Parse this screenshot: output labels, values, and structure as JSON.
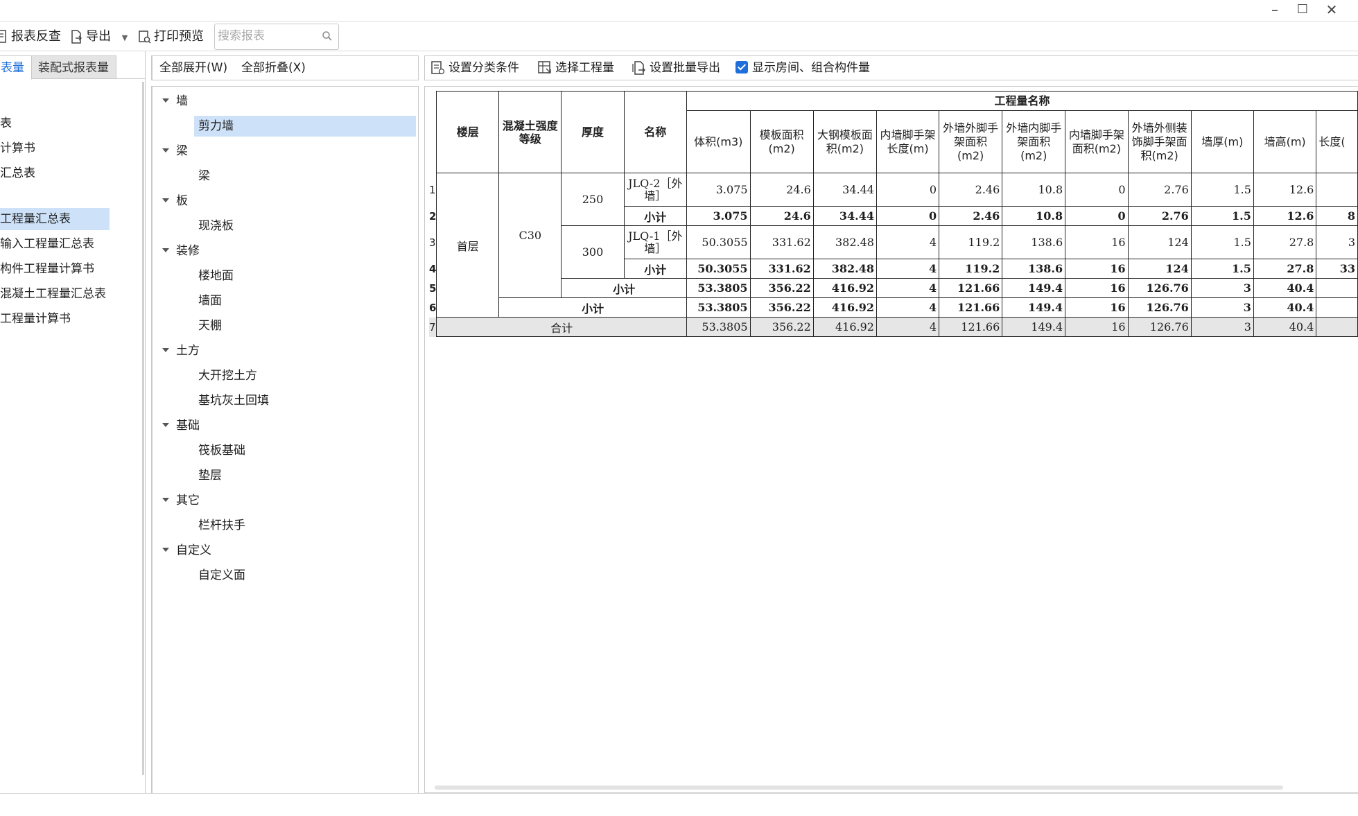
{
  "toolbar": {
    "report_check": "报表反查",
    "export": "导出",
    "print_preview": "打印预览",
    "search_placeholder": "搜索报表"
  },
  "left_panel": {
    "tabs": [
      {
        "label": "表量",
        "active": true
      },
      {
        "label": "装配式报表量",
        "active": false
      }
    ],
    "items": [
      {
        "label": "表",
        "selected": false
      },
      {
        "label": "计算书",
        "selected": false
      },
      {
        "label": "汇总表",
        "selected": false
      },
      {
        "label": "",
        "selected": false
      },
      {
        "label": "工程量汇总表",
        "selected": true
      },
      {
        "label": "输入工程量汇总表",
        "selected": false
      },
      {
        "label": "构件工程量计算书",
        "selected": false
      },
      {
        "label": "混凝土工程量汇总表",
        "selected": false
      },
      {
        "label": "工程量计算书",
        "selected": false
      }
    ]
  },
  "middle_panel": {
    "expand_all": "全部展开(W)",
    "collapse_all": "全部折叠(X)",
    "tree": [
      {
        "group": "墙",
        "children": [
          {
            "label": "剪力墙",
            "selected": true
          }
        ]
      },
      {
        "group": "梁",
        "children": [
          {
            "label": "梁",
            "selected": false
          }
        ]
      },
      {
        "group": "板",
        "children": [
          {
            "label": "现浇板",
            "selected": false
          }
        ]
      },
      {
        "group": "装修",
        "children": [
          {
            "label": "楼地面",
            "selected": false
          },
          {
            "label": "墙面",
            "selected": false
          },
          {
            "label": "天棚",
            "selected": false
          }
        ]
      },
      {
        "group": "土方",
        "children": [
          {
            "label": "大开挖土方",
            "selected": false
          },
          {
            "label": "基坑灰土回填",
            "selected": false
          }
        ]
      },
      {
        "group": "基础",
        "children": [
          {
            "label": "筏板基础",
            "selected": false
          },
          {
            "label": "垫层",
            "selected": false
          }
        ]
      },
      {
        "group": "其它",
        "children": [
          {
            "label": "栏杆扶手",
            "selected": false
          }
        ]
      },
      {
        "group": "自定义",
        "children": [
          {
            "label": "自定义面",
            "selected": false
          }
        ]
      }
    ]
  },
  "right_panel": {
    "set_category": "设置分类条件",
    "select_quantity": "选择工程量",
    "batch_export": "设置批量导出",
    "show_rooms": "显示房间、组合构件量",
    "show_rooms_checked": true
  },
  "table": {
    "group_header": "工程量名称",
    "headers": [
      "楼层",
      "混凝土强度等级",
      "厚度",
      "名称"
    ],
    "sub_headers": [
      "体积(m3)",
      "模板面积(m2)",
      "大钢模板面积(m2)",
      "内墙脚手架长度(m)",
      "外墙外脚手架面积(m2)",
      "外墙内脚手架面积(m2)",
      "内墙脚手架面积(m2)",
      "外墙外侧装饰脚手架面积(m2)",
      "墙厚(m)",
      "墙高(m)",
      "长度("
    ],
    "floor": "首层",
    "grade": "C30",
    "row_numbers": [
      "1",
      "2",
      "3",
      "4",
      "5",
      "6",
      "7"
    ],
    "thickness": [
      "250",
      "300"
    ],
    "names": [
      "JLQ-2［外墙］",
      "小计",
      "JLQ-1［外墙］",
      "小计"
    ],
    "subtotal_label": "小计",
    "total_label": "合计",
    "rows": [
      [
        "3.075",
        "24.6",
        "34.44",
        "0",
        "2.46",
        "10.8",
        "0",
        "2.76",
        "1.5",
        "12.6",
        ""
      ],
      [
        "3.075",
        "24.6",
        "34.44",
        "0",
        "2.46",
        "10.8",
        "0",
        "2.76",
        "1.5",
        "12.6",
        "8"
      ],
      [
        "50.3055",
        "331.62",
        "382.48",
        "4",
        "119.2",
        "138.6",
        "16",
        "124",
        "1.5",
        "27.8",
        "3"
      ],
      [
        "50.3055",
        "331.62",
        "382.48",
        "4",
        "119.2",
        "138.6",
        "16",
        "124",
        "1.5",
        "27.8",
        "33"
      ],
      [
        "53.3805",
        "356.22",
        "416.92",
        "4",
        "121.66",
        "149.4",
        "16",
        "126.76",
        "3",
        "40.4",
        ""
      ],
      [
        "53.3805",
        "356.22",
        "416.92",
        "4",
        "121.66",
        "149.4",
        "16",
        "126.76",
        "3",
        "40.4",
        ""
      ],
      [
        "53.3805",
        "356.22",
        "416.92",
        "4",
        "121.66",
        "149.4",
        "16",
        "126.76",
        "3",
        "40.4",
        ""
      ]
    ]
  }
}
